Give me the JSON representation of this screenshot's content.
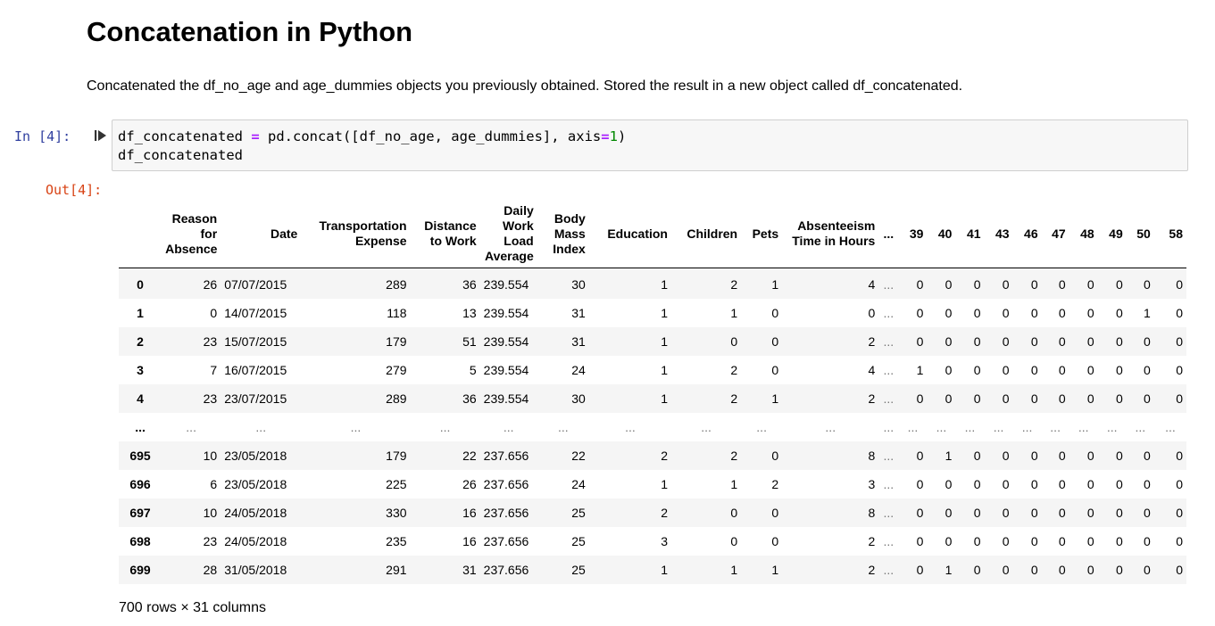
{
  "markdown": {
    "title": "Concatenation in Python",
    "paragraph": "Concatenated the df_no_age and age_dummies objects you previously obtained. Stored the result in a new object called df_concatenated."
  },
  "cell": {
    "in_prompt": "In [4]:",
    "out_prompt": "Out[4]:",
    "code": {
      "l1_a": "df_concatenated ",
      "l1_op": "=",
      "l1_b": " pd.concat([df_no_age, age_dummies], axis",
      "l1_op2": "=",
      "l1_num": "1",
      "l1_c": ")",
      "l2": "df_concatenated"
    }
  },
  "table": {
    "columns": [
      "",
      "Reason for Absence",
      "Date",
      "Transportation Expense",
      "Distance to Work",
      "Daily Work Load Average",
      "Body Mass Index",
      "Education",
      "Children",
      "Pets",
      "Absenteeism Time in Hours",
      "...",
      "39",
      "40",
      "41",
      "43",
      "46",
      "47",
      "48",
      "49",
      "50",
      "58"
    ],
    "rows": [
      [
        "0",
        "26",
        "07/07/2015",
        "289",
        "36",
        "239.554",
        "30",
        "1",
        "2",
        "1",
        "4",
        "...",
        "0",
        "0",
        "0",
        "0",
        "0",
        "0",
        "0",
        "0",
        "0",
        "0"
      ],
      [
        "1",
        "0",
        "14/07/2015",
        "118",
        "13",
        "239.554",
        "31",
        "1",
        "1",
        "0",
        "0",
        "...",
        "0",
        "0",
        "0",
        "0",
        "0",
        "0",
        "0",
        "0",
        "1",
        "0"
      ],
      [
        "2",
        "23",
        "15/07/2015",
        "179",
        "51",
        "239.554",
        "31",
        "1",
        "0",
        "0",
        "2",
        "...",
        "0",
        "0",
        "0",
        "0",
        "0",
        "0",
        "0",
        "0",
        "0",
        "0"
      ],
      [
        "3",
        "7",
        "16/07/2015",
        "279",
        "5",
        "239.554",
        "24",
        "1",
        "2",
        "0",
        "4",
        "...",
        "1",
        "0",
        "0",
        "0",
        "0",
        "0",
        "0",
        "0",
        "0",
        "0"
      ],
      [
        "4",
        "23",
        "23/07/2015",
        "289",
        "36",
        "239.554",
        "30",
        "1",
        "2",
        "1",
        "2",
        "...",
        "0",
        "0",
        "0",
        "0",
        "0",
        "0",
        "0",
        "0",
        "0",
        "0"
      ],
      [
        "...",
        "...",
        "...",
        "...",
        "...",
        "...",
        "...",
        "...",
        "...",
        "...",
        "...",
        "...",
        "...",
        "...",
        "...",
        "...",
        "...",
        "...",
        "...",
        "...",
        "...",
        "..."
      ],
      [
        "695",
        "10",
        "23/05/2018",
        "179",
        "22",
        "237.656",
        "22",
        "2",
        "2",
        "0",
        "8",
        "...",
        "0",
        "1",
        "0",
        "0",
        "0",
        "0",
        "0",
        "0",
        "0",
        "0"
      ],
      [
        "696",
        "6",
        "23/05/2018",
        "225",
        "26",
        "237.656",
        "24",
        "1",
        "1",
        "2",
        "3",
        "...",
        "0",
        "0",
        "0",
        "0",
        "0",
        "0",
        "0",
        "0",
        "0",
        "0"
      ],
      [
        "697",
        "10",
        "24/05/2018",
        "330",
        "16",
        "237.656",
        "25",
        "2",
        "0",
        "0",
        "8",
        "...",
        "0",
        "0",
        "0",
        "0",
        "0",
        "0",
        "0",
        "0",
        "0",
        "0"
      ],
      [
        "698",
        "23",
        "24/05/2018",
        "235",
        "16",
        "237.656",
        "25",
        "3",
        "0",
        "0",
        "2",
        "...",
        "0",
        "0",
        "0",
        "0",
        "0",
        "0",
        "0",
        "0",
        "0",
        "0"
      ],
      [
        "699",
        "28",
        "31/05/2018",
        "291",
        "31",
        "237.656",
        "25",
        "1",
        "1",
        "1",
        "2",
        "...",
        "0",
        "1",
        "0",
        "0",
        "0",
        "0",
        "0",
        "0",
        "0",
        "0"
      ]
    ],
    "summary": "700 rows × 31 columns"
  },
  "icons": {
    "run": "run-cell-icon"
  }
}
